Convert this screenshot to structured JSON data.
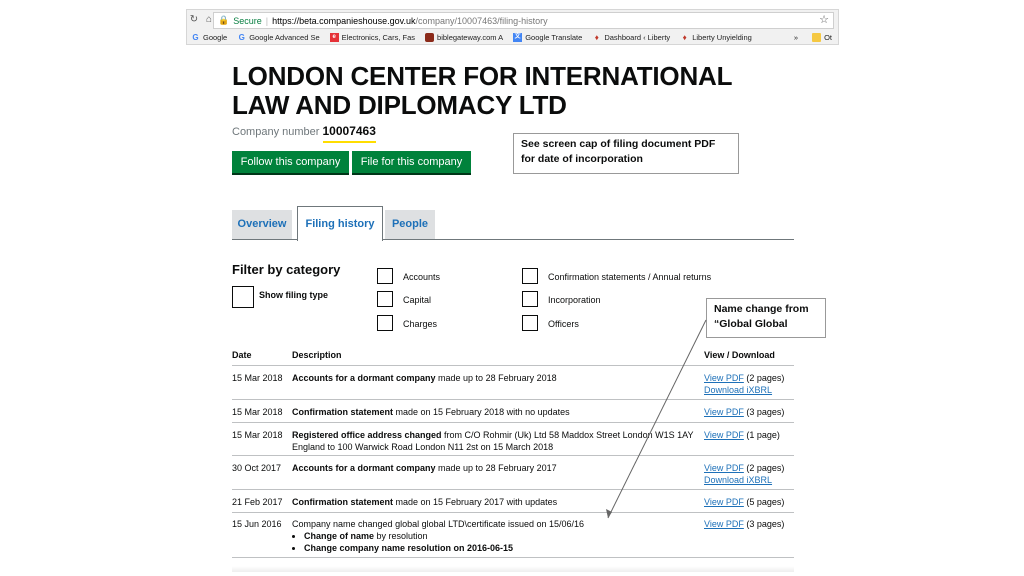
{
  "browser": {
    "secure_label": "Secure",
    "url_host": "https://beta.companieshouse.gov.uk",
    "url_path": "/company/10007463/filing-history",
    "bookmarks": [
      {
        "label": "Google",
        "icon": "google-icon"
      },
      {
        "label": "Google Advanced Se",
        "icon": "google-icon"
      },
      {
        "label": "Electronics, Cars, Fas",
        "icon": "ebay-icon"
      },
      {
        "label": "biblegateway.com A",
        "icon": "biblegateway-icon"
      },
      {
        "label": "Google Translate",
        "icon": "translate-icon"
      },
      {
        "label": "Dashboard ‹ Liberty",
        "icon": "flame-icon"
      },
      {
        "label": "Liberty Unyielding",
        "icon": "flame-icon"
      }
    ],
    "more": "»",
    "other": "Ot"
  },
  "company": {
    "name_line1": "LONDON CENTER FOR INTERNATIONAL",
    "name_line2": "LAW AND DIPLOMACY LTD",
    "number_label": "Company number",
    "number": "10007463"
  },
  "actions": {
    "follow": "Follow this company",
    "file": "File for this company"
  },
  "annotations": {
    "note1": "See screen cap of filing document PDF for date of incorporation",
    "note2": "Name change from “Global Global"
  },
  "tabs": [
    {
      "label": "Overview"
    },
    {
      "label": "Filing history"
    },
    {
      "label": "People"
    }
  ],
  "filter": {
    "heading": "Filter by category",
    "show_type": "Show filing type",
    "col1": [
      "Accounts",
      "Capital",
      "Charges"
    ],
    "col2": [
      "Confirmation statements / Annual returns",
      "Incorporation",
      "Officers"
    ]
  },
  "table": {
    "headers": {
      "date": "Date",
      "description": "Description",
      "view": "View / Download"
    },
    "rows": [
      {
        "date": "15 Mar 2018",
        "bold": "Accounts for a dormant company",
        "text": " made up to 28 February 2018",
        "view": "View PDF",
        "pages": " (2 pages)",
        "extra": "Download iXBRL"
      },
      {
        "date": "15 Mar 2018",
        "bold": "Confirmation statement",
        "text": " made on 15 February 2018 with no updates",
        "view": "View PDF",
        "pages": " (3 pages)"
      },
      {
        "date": "15 Mar 2018",
        "bold": "Registered office address changed",
        "text": " from C/O Rohmir (Uk) Ltd 58 Maddox Street London W1S 1AY England to 100 Warwick Road London N11 2st on 15 March 2018",
        "view": "View PDF",
        "pages": " (1 page)"
      },
      {
        "date": "30 Oct 2017",
        "bold": "Accounts for a dormant company",
        "text": " made up to 28 February 2017",
        "view": "View PDF",
        "pages": " (2 pages)",
        "extra": "Download iXBRL"
      },
      {
        "date": "21 Feb 2017",
        "bold": "Confirmation statement",
        "text": " made on 15 February 2017 with updates",
        "view": "View PDF",
        "pages": " (5 pages)"
      },
      {
        "date": "15 Jun 2016",
        "bold": "",
        "text": "Company name changed global global LTD\\certificate issued on 15/06/16",
        "view": "View PDF",
        "pages": " (3 pages)",
        "bullets": [
          {
            "b": "Change of name",
            "t": " by resolution"
          },
          {
            "b": "Change company name resolution on 2016-06-15",
            "t": ""
          }
        ]
      }
    ]
  }
}
